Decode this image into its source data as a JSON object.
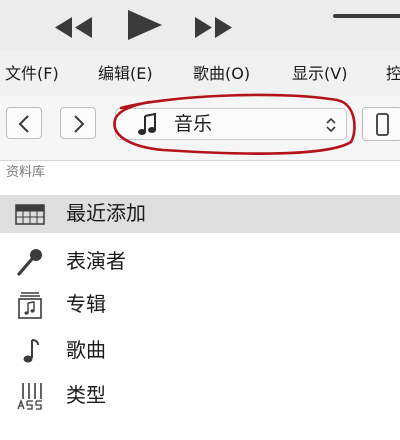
{
  "menu": {
    "items": [
      "文件(F)",
      "编辑(E)",
      "歌曲(O)",
      "显示(V)",
      "控"
    ]
  },
  "toolbar": {
    "source_select_value": "音乐"
  },
  "library": {
    "header": "资料库",
    "items": [
      {
        "label": "最近添加",
        "icon": "recently-added-grid-icon",
        "selected": true
      },
      {
        "label": "表演者",
        "icon": "microphone-icon",
        "selected": false
      },
      {
        "label": "专辑",
        "icon": "album-icon",
        "selected": false
      },
      {
        "label": "歌曲",
        "icon": "music-note-icon",
        "selected": false
      },
      {
        "label": "类型",
        "icon": "genre-icon",
        "selected": false
      }
    ]
  },
  "colors": {
    "annotation": "#b3141c",
    "selected_row": "#dedede",
    "icon": "#3c3c3c"
  }
}
